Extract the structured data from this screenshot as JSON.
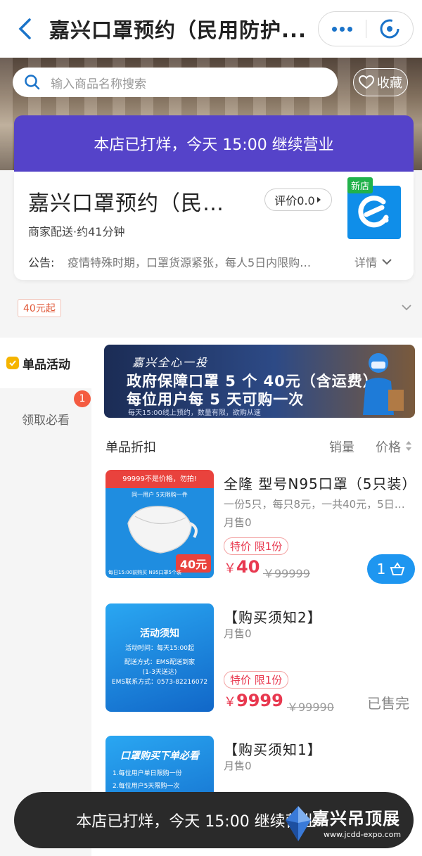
{
  "header": {
    "title": "嘉兴口罩预约（民用防护...",
    "more_icon": "more-dots-icon",
    "close_icon": "close-circle-icon"
  },
  "search": {
    "placeholder": "输入商品名称搜索"
  },
  "favorite_label": "收藏",
  "shop": {
    "notice_bar": "本店已打烊，今天 15:00 继续营业",
    "name": "嘉兴口罩预约（民…",
    "rating": "评价0.0",
    "delivery": "商家配送·约41分钟",
    "new_tag": "新店",
    "announce_label": "公告:",
    "announce_text": "疫情特殊时期，口罩货源紧张，每人5日内限购…",
    "detail_label": "详情"
  },
  "min_order": "40元起",
  "sidebar": {
    "items": [
      {
        "label": "单品活动"
      },
      {
        "label": "领取必看",
        "badge": "1"
      }
    ]
  },
  "promo": {
    "line1": "嘉兴全心一投",
    "line2": "政府保障口罩 5 个 40元（含运费）",
    "line3": "每位用户每 5 天可购一次",
    "line4": "每天15:00线上预约，数量有限，欲购从速"
  },
  "list": {
    "title": "单品折扣",
    "sort_sales": "销量",
    "sort_price": "价格"
  },
  "products": [
    {
      "name": "全隆 型号N95口罩（5只装）",
      "desc": "一份5只，每只8元，一共40元，5日…",
      "sold": "月售0",
      "tag": "特价 限1份",
      "price_symbol": "￥",
      "price": "40",
      "orig_price": "￥99999",
      "cart_count": "1",
      "thumb_top": "99999不是价格，勿拍!",
      "thumb_sub": "同一用户 5天限购一件",
      "thumb_price": "40元",
      "thumb_bottom": "每日15:00前购买 N95口罩5个装"
    },
    {
      "name": "【购买须知2】",
      "sold": "月售0",
      "tag": "特价 限1份",
      "price_symbol": "￥",
      "price": "9999",
      "orig_price": "￥99990",
      "status": "已售完",
      "thumb_title": "活动须知",
      "thumb_l1": "活动时间：每天15:00起",
      "thumb_l2": "配送方式：EMS配送到家",
      "thumb_l3": "(1-3天送达)",
      "thumb_l4": "EMS联系方式：0573-82216072"
    },
    {
      "name": "【购买须知1】",
      "sold": "月售0",
      "thumb_title": "口罩购买下单必看",
      "thumb_l1": "1.每位用户单日限购一份",
      "thumb_l2": "2.每位用户5天限购一次"
    }
  ],
  "toast": "本店已打烊，今天 15:00 继续营业",
  "watermark": {
    "text": "嘉兴吊顶展",
    "url": "www.jcdd-expo.com"
  },
  "colors": {
    "brand_blue": "#1e96f0",
    "notice_purple": "#5543c9",
    "price_red": "#e8384f"
  }
}
